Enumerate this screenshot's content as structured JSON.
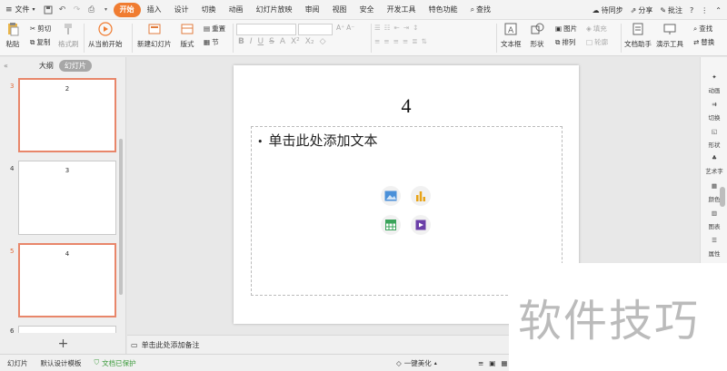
{
  "menubar": {
    "file_label": "文件",
    "tabs": [
      "开始",
      "插入",
      "设计",
      "切换",
      "动画",
      "幻灯片放映",
      "审阅",
      "视图",
      "安全",
      "开发工具",
      "特色功能"
    ],
    "search_label": "查找",
    "sync_label": "待同步",
    "share_label": "分享",
    "comment_label": "批注"
  },
  "ribbon": {
    "paste": "粘贴",
    "cut": "剪切",
    "copy": "复制",
    "format_painter": "格式刷",
    "start_from_current": "从当前开始",
    "new_slide": "新建幻灯片",
    "layout": "版式",
    "reset": "重置",
    "section": "节",
    "textbox": "文本框",
    "shape": "形状",
    "arrange": "排列",
    "picture": "图片",
    "fill": "填充",
    "outline": "轮廓",
    "doc_assistant": "文档助手",
    "presenter_tools": "演示工具",
    "find": "查找",
    "replace": "替换",
    "format_buttons": [
      "B",
      "I",
      "U",
      "S",
      "X²",
      "X₂"
    ]
  },
  "left_panel": {
    "tab_outline": "大纲",
    "tab_slides": "幻灯片",
    "slides": [
      {
        "num": "3",
        "title": "2",
        "selected": true
      },
      {
        "num": "4",
        "title": "3",
        "selected": false
      },
      {
        "num": "5",
        "title": "4",
        "selected": true
      },
      {
        "num": "6",
        "title": "",
        "selected": false
      }
    ],
    "add_slide": "+"
  },
  "slide": {
    "title": "4",
    "placeholder_text": "单击此处添加文本"
  },
  "notes": {
    "placeholder": "单击此处添加备注"
  },
  "right_sidebar": {
    "items": [
      "动画",
      "切换",
      "形状",
      "艺术字",
      "颜色",
      "图表",
      "属性"
    ]
  },
  "statusbar": {
    "slide_label": "幻灯片",
    "design_template": "默认设计模板",
    "doc_protected": "文档已保护",
    "beautify": "一键美化"
  },
  "watermark": {
    "text": "软件技巧"
  },
  "colors": {
    "accent": "#f07c31",
    "selected_border": "#e8866a"
  }
}
